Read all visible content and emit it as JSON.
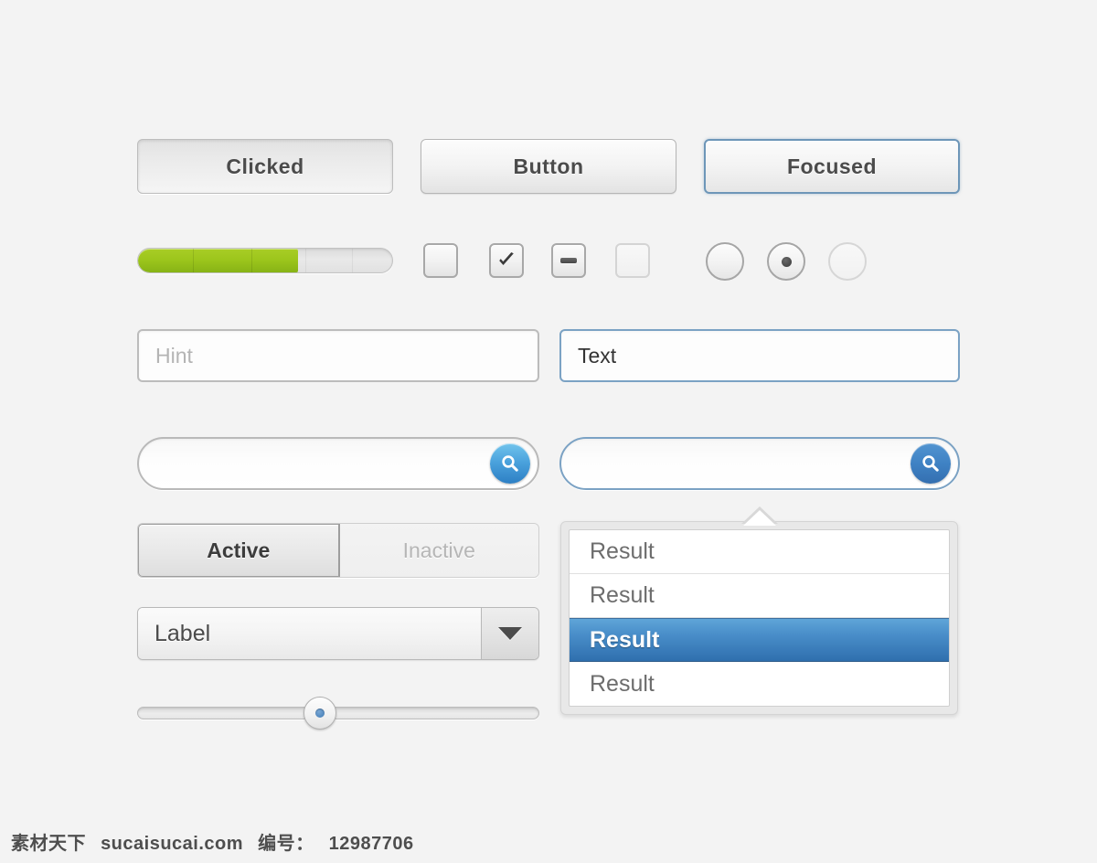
{
  "theme": {
    "background": "#f3f3f3",
    "accent_blue": "#3f82c4",
    "focus_border": "#7ba2c4",
    "progress_green": "#9dc61c",
    "text_dark": "#4b4b4b",
    "text_muted": "#b4b4b4"
  },
  "buttons": {
    "clicked": {
      "label": "Clicked",
      "state": "pressed"
    },
    "normal": {
      "label": "Button",
      "state": "default"
    },
    "focused": {
      "label": "Focused",
      "state": "focused"
    }
  },
  "progress": {
    "value": 63,
    "max": 100,
    "segments": 3
  },
  "checkboxes": [
    {
      "name": "checkbox-unchecked",
      "state": "unchecked",
      "icon": "none"
    },
    {
      "name": "checkbox-checked",
      "state": "checked",
      "icon": "check-icon"
    },
    {
      "name": "checkbox-indeterminate",
      "state": "indeterminate",
      "icon": "dash-icon"
    },
    {
      "name": "checkbox-disabled",
      "state": "disabled",
      "icon": "none"
    }
  ],
  "radios": [
    {
      "name": "radio-unselected",
      "state": "unselected"
    },
    {
      "name": "radio-selected",
      "state": "selected"
    },
    {
      "name": "radio-disabled",
      "state": "disabled"
    }
  ],
  "text_fields": {
    "hint": {
      "value": "",
      "placeholder": "Hint",
      "state": "default"
    },
    "text": {
      "value": "Text",
      "placeholder": "",
      "state": "focused"
    }
  },
  "search_fields": {
    "default": {
      "value": "",
      "placeholder": "",
      "button_icon": "search-icon",
      "state": "default"
    },
    "focused": {
      "value": "",
      "placeholder": "",
      "button_icon": "search-icon",
      "state": "focused"
    }
  },
  "segmented": {
    "options": [
      {
        "label": "Active",
        "selected": true
      },
      {
        "label": "Inactive",
        "selected": false
      }
    ]
  },
  "select": {
    "value": "Label",
    "arrow_icon": "chevron-down-icon"
  },
  "slider": {
    "value": 45,
    "min": 0,
    "max": 100
  },
  "results_dropdown": {
    "items": [
      {
        "label": "Result",
        "selected": false
      },
      {
        "label": "Result",
        "selected": false
      },
      {
        "label": "Result",
        "selected": true
      },
      {
        "label": "Result",
        "selected": false
      }
    ]
  },
  "watermark": {
    "site_cn": "素材天下",
    "site_url": "sucaisucai.com",
    "id_label": "编号：",
    "id_value": "12987706"
  }
}
